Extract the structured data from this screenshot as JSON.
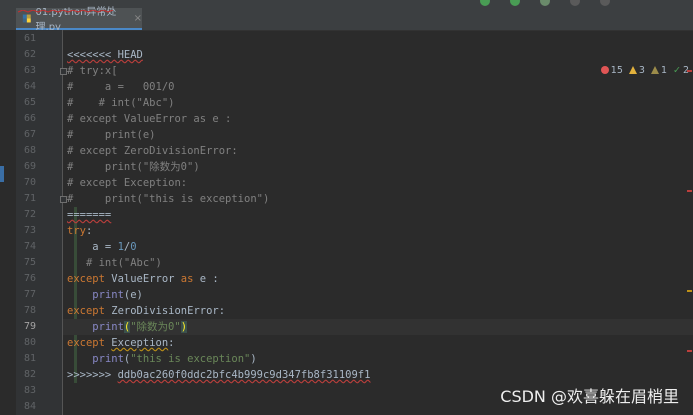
{
  "tab": {
    "file_name": "01.python异常处理.py",
    "close_glyph": "×",
    "icon": "python-file-icon"
  },
  "inspections": {
    "errors": "15",
    "warnings": "3",
    "weak_warnings": "1",
    "typos": "2",
    "colors": {
      "error": "#e05555",
      "warning": "#e2b13c",
      "weak": "#9c8c4a",
      "ok": "#499c54"
    }
  },
  "gutter": {
    "line_numbers": [
      "61",
      "62",
      "63",
      "64",
      "65",
      "66",
      "67",
      "68",
      "69",
      "70",
      "71",
      "72",
      "73",
      "74",
      "75",
      "76",
      "77",
      "78",
      "79",
      "80",
      "81",
      "82",
      "83",
      "84"
    ],
    "current_line": "79"
  },
  "code": {
    "l62": "<<<<<<< HEAD",
    "l63": "# try:x[",
    "l64": "#     a =   001/0",
    "l65": "#    # int(\"Abc\")",
    "l66": "# except ValueError as e :",
    "l67": "#     print(e)",
    "l68": "# except ZeroDivisionError:",
    "l69": "#     print(\"除数为0\")",
    "l70": "# except Exception:",
    "l71": "#     print(\"this is exception\")",
    "l72": "=======",
    "l73_kw": "try",
    "l73_rest": ":",
    "l74_pre": "    a = ",
    "l74_num1": "1",
    "l74_op": "/",
    "l74_num2": "0",
    "l75": "   # int(\"Abc\")",
    "l76_kw1": "except",
    "l76_cls": " ValueError ",
    "l76_kw2": "as",
    "l76_rest": " e :",
    "l77_indent": "    ",
    "l77_fn": "print",
    "l77_rest": "(e)",
    "l78_kw": "except",
    "l78_rest": " ZeroDivisionError:",
    "l79_indent": "    ",
    "l79_fn": "print",
    "l79_open": "(",
    "l79_str": "\"除数为0\"",
    "l79_close": ")",
    "l80_kw": "except",
    "l80_sp": " ",
    "l80_cls": "Exception",
    "l80_rest": ":",
    "l81_indent": "    ",
    "l81_fn": "print",
    "l81_open": "(",
    "l81_str": "\"this is exception\"",
    "l81_close": ")",
    "l82_marker": ">>>>>>> ",
    "l82_hash": "ddb0ac260f0ddc2bfc4b999c9d347fb8f31109f1"
  },
  "watermark": "CSDN @欢喜躲在眉梢里"
}
